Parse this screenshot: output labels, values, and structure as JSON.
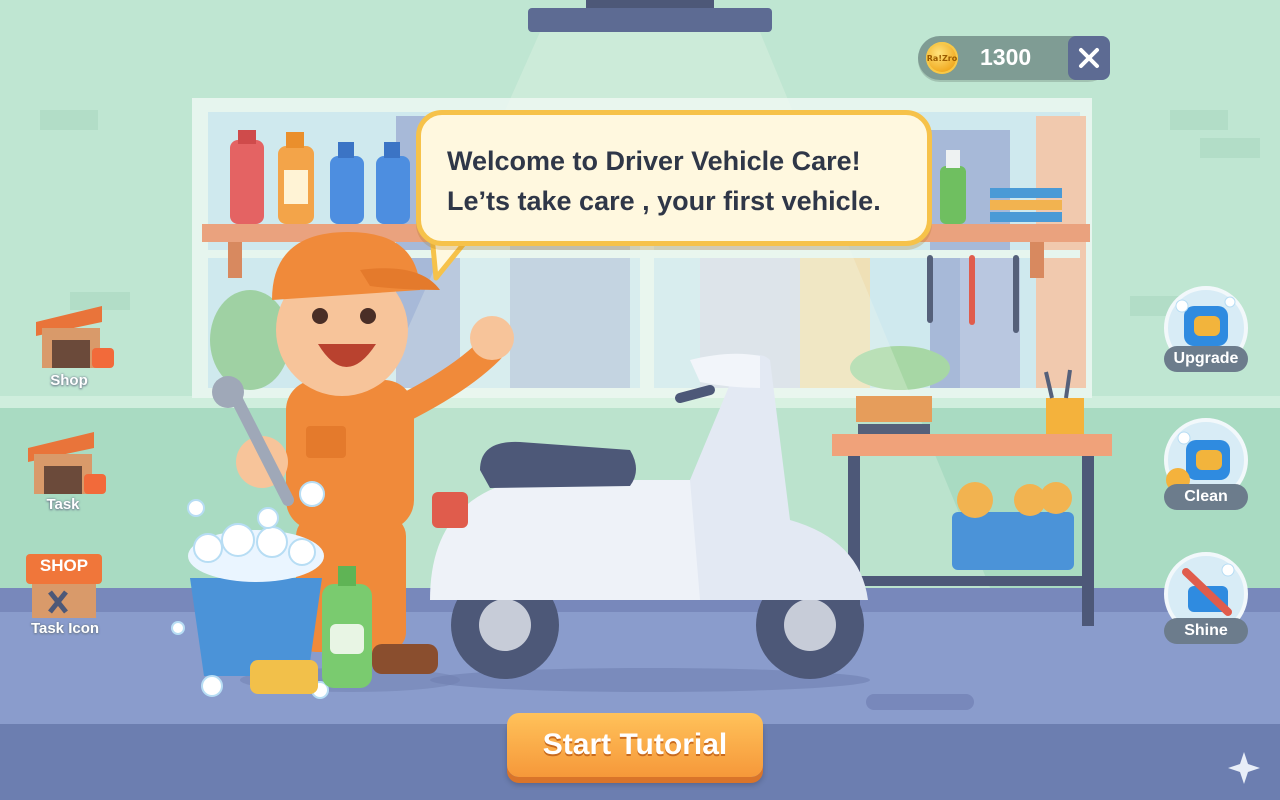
{
  "game": {
    "coins": "1300",
    "coin_icon_text": "Ra!Zro",
    "close_icon": "close-icon"
  },
  "dialog": {
    "line1": "Welcome to Driver Vehicle Care!",
    "line2": "Le’ts take care , your first vehicle."
  },
  "left_menu": {
    "shop": "Shop",
    "task": "Task",
    "task_icon": "Task Icon",
    "shop_sign": "SHOP"
  },
  "right_tools": {
    "upgrade": "Upgrade",
    "clean": "Clean",
    "shine": "Shine"
  },
  "tutorial": {
    "start_label": "Start Tutorial"
  },
  "colors": {
    "wall": "#bfe6d2",
    "floor": "#7d8fc1",
    "accent_orange": "#f6983a",
    "bubble_border": "#f6c24a",
    "mechanic_uniform": "#f08a3a"
  }
}
